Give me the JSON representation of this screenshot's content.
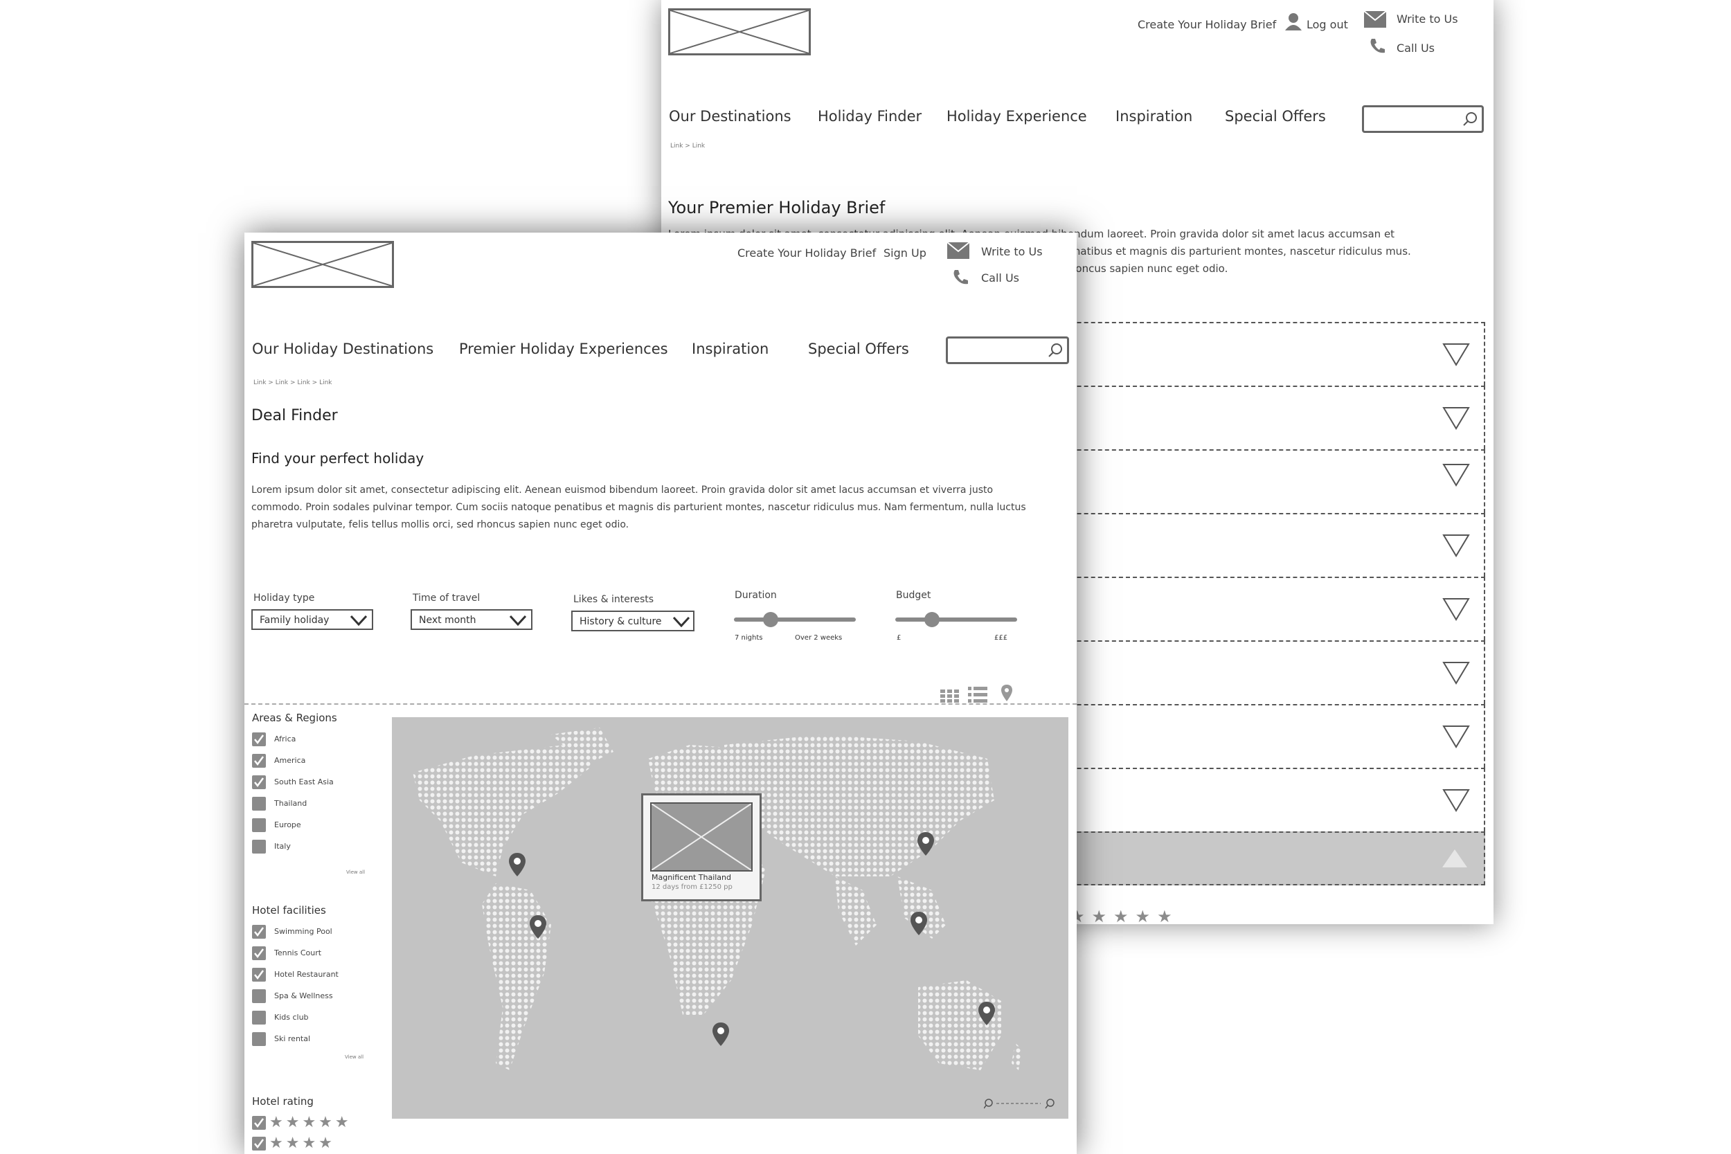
{
  "back_page": {
    "header": {
      "create_brief": "Create Your Holiday Brief",
      "log_out": "Log out",
      "write_to_us": "Write to Us",
      "call_us": "Call Us"
    },
    "nav": [
      "Our Destinations",
      "Holiday Finder",
      "Holiday Experience",
      "Inspiration",
      "Special Offers"
    ],
    "breadcrumb": "Link > Link",
    "title": "Your Premier Holiday Brief",
    "intro_lines": [
      "Lorem ipsum dolor sit amet, consectetur adipiscing elit. Aenean euismod bibendum laoreet. Proin gravida dolor sit amet lacus accumsan et",
      "viverra justo commodo. Proin sodales pulvinar tempor. Cum sociis natoque penatibus et magnis dis parturient montes, nascetur ridiculus mus.",
      "Nam fermentum, nulla luctus pharetra vulputate, felis tellus mollis orci, sed rhoncus sapien nunc eget odio."
    ],
    "accordion_rows": 8,
    "rating_stars": "★★★★★"
  },
  "front_page": {
    "header": {
      "create_brief": "Create Your Holiday Brief",
      "sign_up": "Sign Up",
      "write_to_us": "Write to Us",
      "call_us": "Call Us"
    },
    "nav": [
      "Our Holiday Destinations",
      "Premier Holiday Experiences",
      "Inspiration",
      "Special Offers"
    ],
    "breadcrumb": "Link > Link > Link > Link",
    "title": "Deal Finder",
    "subtitle": "Find your perfect holiday",
    "intro_lines": [
      "Lorem ipsum dolor sit amet, consectetur adipiscing elit. Aenean euismod bibendum laoreet. Proin gravida dolor sit amet lacus accumsan et viverra justo",
      "commodo. Proin sodales pulvinar tempor. Cum sociis natoque penatibus et magnis dis parturient montes, nascetur ridiculus mus. Nam fermentum, nulla luctus",
      "pharetra vulputate, felis tellus mollis orci, sed rhoncus sapien nunc eget odio."
    ],
    "filters": {
      "holiday_type": {
        "label": "Holiday type",
        "value": "Family holiday"
      },
      "time_of_travel": {
        "label": "Time of travel",
        "value": "Next month"
      },
      "likes_interests": {
        "label": "Likes & interests",
        "value": "History & culture"
      },
      "duration": {
        "label": "Duration",
        "min": "7 nights",
        "max": "Over 2 weeks",
        "position": 0.3
      },
      "budget": {
        "label": "Budget",
        "min": "£",
        "max": "£££",
        "position": 0.3
      }
    },
    "view_icons": [
      "grid-view-icon",
      "list-view-icon",
      "map-view-icon"
    ],
    "sidebar": {
      "areas": {
        "title": "Areas & Regions",
        "items": [
          {
            "label": "Africa",
            "checked": true
          },
          {
            "label": "America",
            "checked": true
          },
          {
            "label": "South East Asia",
            "checked": true
          },
          {
            "label": "Thailand",
            "checked": false
          },
          {
            "label": "Europe",
            "checked": false
          },
          {
            "label": "Italy",
            "checked": false
          }
        ],
        "view_all": "View all"
      },
      "facilities": {
        "title": "Hotel facilities",
        "items": [
          {
            "label": "Swimming Pool",
            "checked": true
          },
          {
            "label": "Tennis Court",
            "checked": true
          },
          {
            "label": "Hotel Restaurant",
            "checked": true
          },
          {
            "label": "Spa & Wellness",
            "checked": false
          },
          {
            "label": "Kids club",
            "checked": false
          },
          {
            "label": "Ski rental",
            "checked": false
          }
        ],
        "view_all": "View all"
      },
      "rating": {
        "title": "Hotel rating",
        "rows": [
          {
            "stars": "★★★★★",
            "checked": true
          },
          {
            "stars": "★★★★",
            "checked": true
          }
        ]
      }
    },
    "map": {
      "popup_title": "Magnificent Thailand",
      "popup_detail": "12 days  from £1250 pp"
    }
  }
}
